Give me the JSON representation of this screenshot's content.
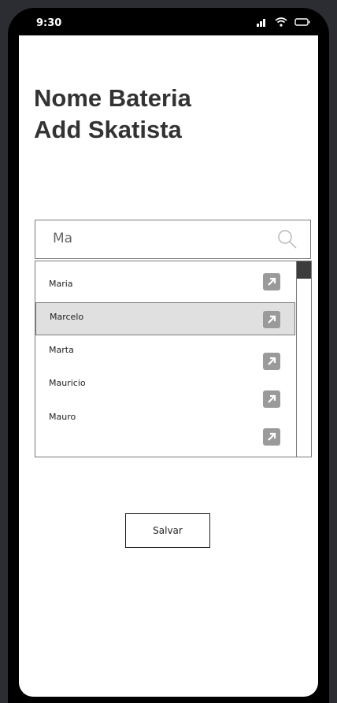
{
  "status_bar": {
    "time": "9:30",
    "icons": [
      "signal-icon",
      "wifi-icon",
      "battery-icon"
    ]
  },
  "page": {
    "title_line1": "Nome Bateria",
    "title_line2": "Add Skatista"
  },
  "search": {
    "value": "Ma",
    "icon": "search-icon"
  },
  "results": {
    "items": [
      {
        "label": "Maria",
        "selected": false
      },
      {
        "label": "Marcelo",
        "selected": true
      },
      {
        "label": "Marta",
        "selected": false
      },
      {
        "label": "Mauricio",
        "selected": false
      },
      {
        "label": "Mauro",
        "selected": false
      }
    ],
    "item_icon": "open-external-icon"
  },
  "actions": {
    "save_label": "Salvar"
  },
  "colors": {
    "background": "#2b2d33",
    "screen": "#ffffff",
    "title": "#333333",
    "selected_row": "#e0e0e0",
    "icon_fill": "#9a9a9a",
    "scroll_thumb": "#3c3c3c"
  }
}
